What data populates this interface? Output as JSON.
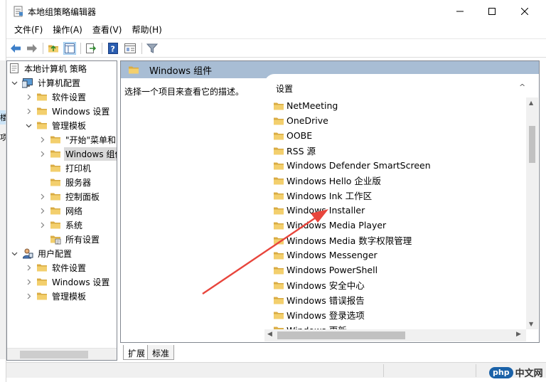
{
  "window": {
    "title": "本地组策略编辑器"
  },
  "menu": [
    {
      "label": "文件(F)"
    },
    {
      "label": "操作(A)"
    },
    {
      "label": "查看(V)"
    },
    {
      "label": "帮助(H)"
    }
  ],
  "tree": {
    "root": "本地计算机 策略",
    "computer_config": "计算机配置",
    "software_settings": "软件设置",
    "windows_settings": "Windows 设置",
    "admin_templates": "管理模板",
    "start_menu": "\"开始\"菜单和",
    "windows_components": "Windows 组件",
    "printers": "打印机",
    "server": "服务器",
    "control_panel": "控制面板",
    "network": "网络",
    "system": "系统",
    "all_settings": "所有设置",
    "user_config": "用户配置",
    "u_software_settings": "软件设置",
    "u_windows_settings": "Windows 设置",
    "u_admin_templates": "管理模板"
  },
  "right": {
    "header": "Windows 组件",
    "description": "选择一个项目来查看它的描述。",
    "list_header": "设置",
    "items": [
      "NetMeeting",
      "OneDrive",
      "OOBE",
      "RSS 源",
      "Windows Defender SmartScreen",
      "Windows Hello 企业版",
      "Windows Ink 工作区",
      "Windows Installer",
      "Windows Media Player",
      "Windows Media 数字权限管理",
      "Windows Messenger",
      "Windows PowerShell",
      "Windows 安全中心",
      "Windows 错误报告",
      "Windows 登录选项",
      "Windows 更新"
    ]
  },
  "tabs": [
    {
      "label": "扩展"
    },
    {
      "label": "标准"
    }
  ],
  "clipped_left": {
    "c1": "楼",
    "c2": "项"
  },
  "watermark": {
    "logo": "php",
    "text": "中文网"
  },
  "colors": {
    "accent_header": "#a8bdd4",
    "folder": "#e8c262",
    "arrow": "#e8453c",
    "selection": "#d9d9d9"
  }
}
